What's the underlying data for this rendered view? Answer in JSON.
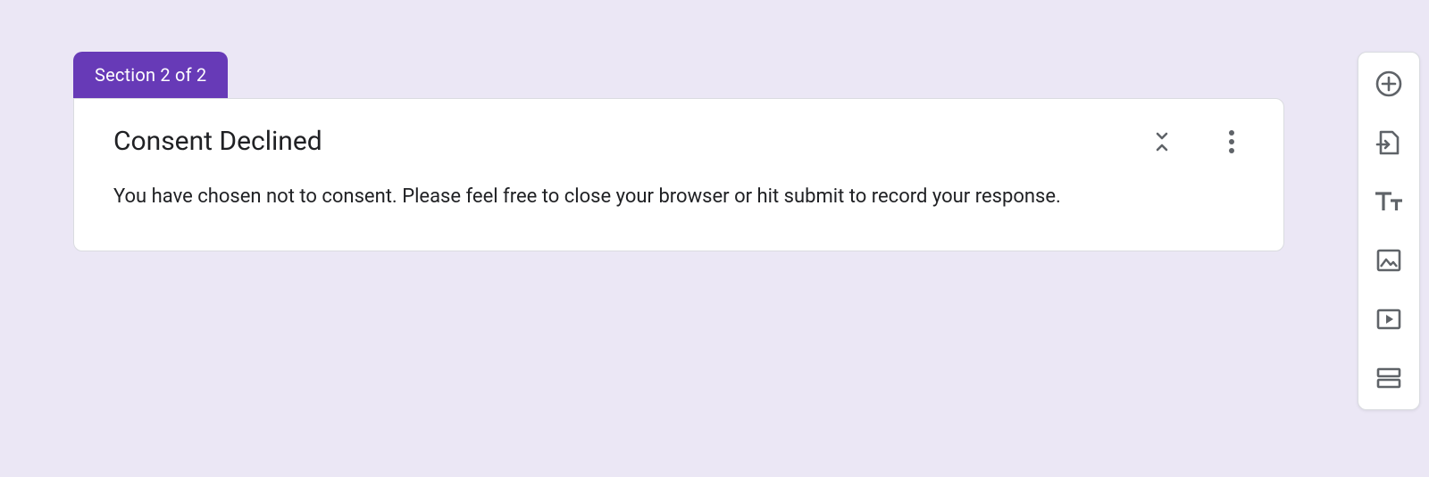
{
  "section": {
    "tab_label": "Section 2 of 2",
    "title": "Consent Declined",
    "description": "You have chosen not to consent. Please feel free to close your browser or hit submit to record your response."
  },
  "colors": {
    "brand": "#673ab7",
    "background": "#ebe7f5"
  }
}
